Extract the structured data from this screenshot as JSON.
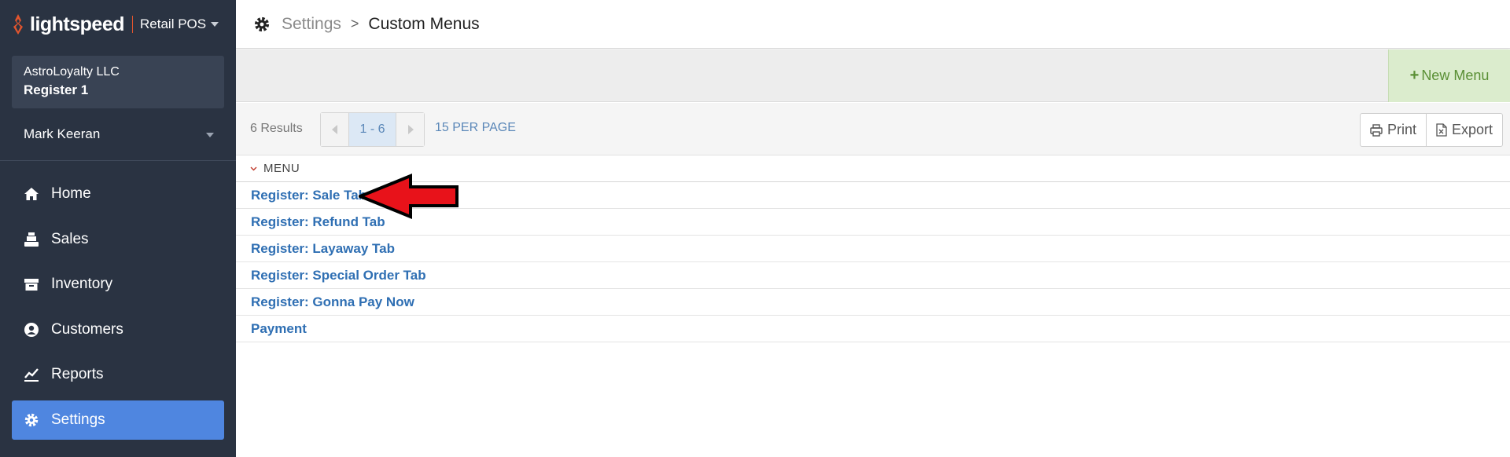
{
  "brand": {
    "logo_text": "lightspeed",
    "product": "Retail POS"
  },
  "store": {
    "name": "AstroLoyalty LLC",
    "register": "Register 1"
  },
  "user": {
    "name": "Mark Keeran"
  },
  "nav": {
    "items": [
      {
        "label": "Home",
        "icon": "home-icon"
      },
      {
        "label": "Sales",
        "icon": "register-icon"
      },
      {
        "label": "Inventory",
        "icon": "inventory-box-icon"
      },
      {
        "label": "Customers",
        "icon": "customer-icon"
      },
      {
        "label": "Reports",
        "icon": "chart-icon"
      },
      {
        "label": "Settings",
        "icon": "gear-icon",
        "active": true
      }
    ]
  },
  "breadcrumb": {
    "parent": "Settings",
    "separator": ">",
    "current": "Custom Menus"
  },
  "actions": {
    "new_menu_label": "New Menu",
    "new_menu_icon": "+"
  },
  "paging": {
    "results": "6 Results",
    "range": "1 - 6",
    "per_page": "15 PER PAGE"
  },
  "tools": {
    "print_label": "Print",
    "export_label": "Export"
  },
  "table": {
    "column_header": "MENU",
    "rows": [
      "Register: Sale Tab",
      "Register: Refund Tab",
      "Register: Layaway Tab",
      "Register: Special Order Tab",
      "Register: Gonna Pay Now",
      "Payment"
    ]
  },
  "colors": {
    "sidebar_bg": "#2a3342",
    "active_nav": "#4f86e0",
    "link": "#2f6fb3",
    "new_menu_bg": "#dbeccd",
    "new_menu_text": "#5a8f35",
    "brand_accent": "#e2552e",
    "annotation_arrow": "#e8121a"
  }
}
